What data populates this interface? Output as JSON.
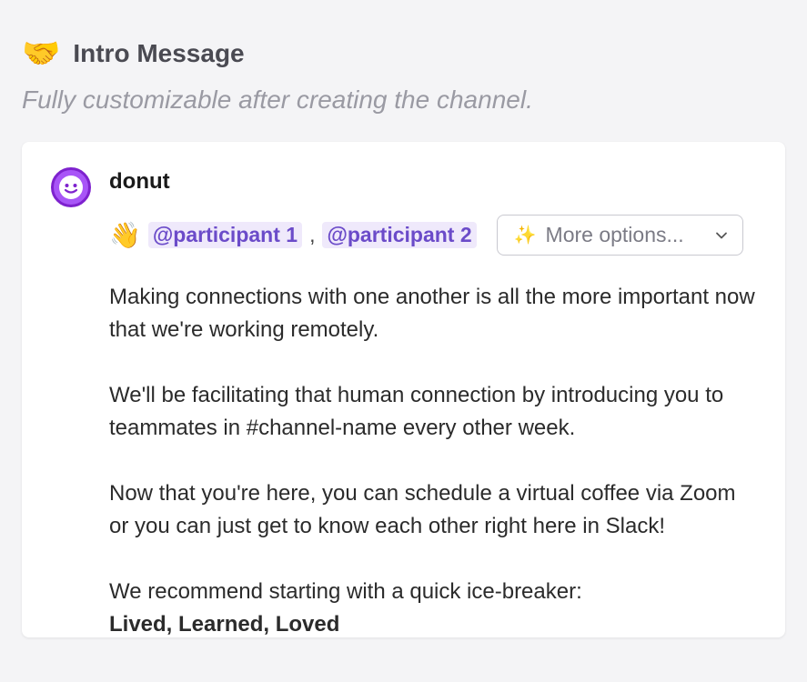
{
  "header": {
    "icon": "🤝",
    "title": "Intro Message",
    "subtitle": "Fully customizable after creating the channel."
  },
  "message": {
    "avatar_face": "☺",
    "bot_name": "donut",
    "wave": "👋",
    "mentions": [
      "@participant 1",
      "@participant 2"
    ],
    "mention_separator": ",",
    "dropdown": {
      "sparkle": "✨",
      "label": "More options..."
    },
    "paragraphs": [
      "Making connections with one another is all the more important now that we're working remotely.",
      "We'll be facilitating that human connection by introducing you to teammates in #channel-name every other week.",
      "Now that you're here, you can schedule a virtual coffee via Zoom or you can just get to know each other right here in Slack!"
    ],
    "icebreaker_intro": "We recommend starting with a quick ice-breaker:",
    "icebreaker_title": "Lived, Learned, Loved"
  }
}
